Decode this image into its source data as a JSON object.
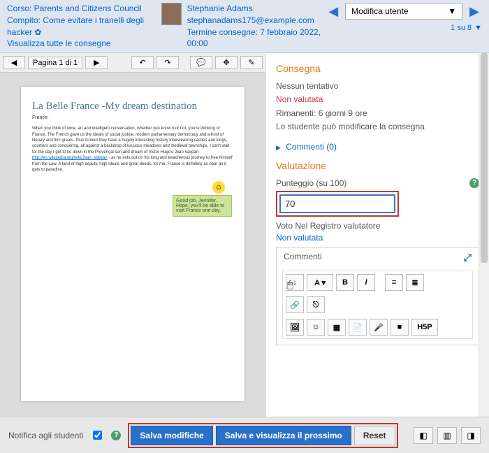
{
  "header": {
    "course_link": "Corso: Parents and Citizens Council",
    "assignment_link": "Compito: Come evitare i tranelli degli hacker ✿",
    "view_all_link": "Visualizza tutte le consegne",
    "student_name": "Stephanie Adams",
    "student_email": "stephanadams175@example.com",
    "due_line": "Termine consegne: 7 febbraio 2022, 00:00",
    "change_user_label": "Modifica utente",
    "pager": "1 su 8"
  },
  "pdf": {
    "page_label": "Pagina 1 di 1",
    "title": "La Belle France -My dream destination",
    "subtitle": "France:",
    "body1": "When you think of wine, art and intelligent conversation, whether you know it or not, you're thinking of France. The French gave us the ideals of social justice, modern parliamentary democracy and a host of literary and film greats. Plus to boot they have a hugely interesting history interweaving castles and kings, courtiers and conquering, all against a backdrop of luscious meadows and medieval townships. I can't wait for the day I get to lie down in the Provençal sun and dream of Victor Hugo's Jean Valjean- ",
    "body_link": "http://en.wikipedia.org/wiki/Jean_Valjean",
    "body2": " - as he sets out on his long and treacherous journey to free himself from the Law. A land of high beauty, high ideals and great deeds, for me, France is definitely as near as it gets to paradise.",
    "note": "Good job, Jennifer. Hope, you'll be able to visit France one day."
  },
  "submission": {
    "heading": "Consegna",
    "line1": "Nessun tentativo",
    "line2": "Non valutata",
    "line3": "Rimanenti: 6 giorni 9 ore",
    "line4": "Lo studente può modificare la consegna",
    "comments": "Commenti (0)"
  },
  "grading": {
    "heading": "Valutazione",
    "score_label": "Punteggio (su 100)",
    "score_value": "70",
    "gradebook_line": "Voto Nel Registro valutatore",
    "not_graded": "Non valutata",
    "comments_label": "Commenti"
  },
  "footer": {
    "notify_label": "Notifica agli studenti",
    "save": "Salva modifiche",
    "save_next": "Salva e visualizza il prossimo",
    "reset": "Reset"
  },
  "chart_data": {
    "type": "table",
    "title": "Grading panel values",
    "categories": [
      "Punteggio"
    ],
    "values": [
      70
    ],
    "ylim": [
      0,
      100
    ]
  }
}
